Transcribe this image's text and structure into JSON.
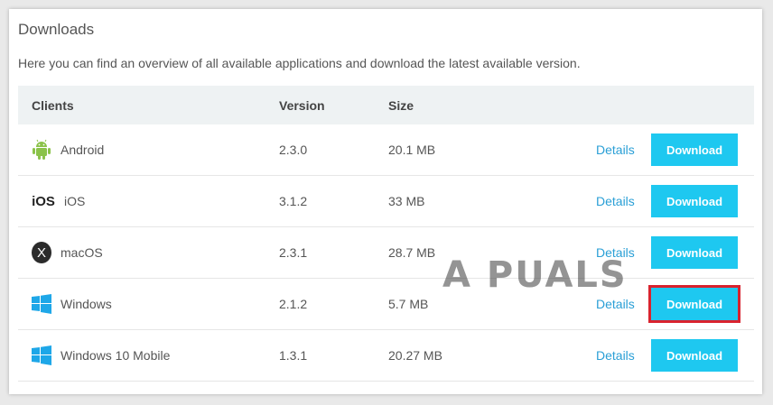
{
  "section": {
    "title": "Downloads",
    "description": "Here you can find an overview of all available applications and download the latest available version."
  },
  "table": {
    "headers": {
      "client": "Clients",
      "version": "Version",
      "size": "Size"
    },
    "rows": [
      {
        "client": "Android",
        "icon": "android-icon",
        "version": "2.3.0",
        "size": "20.1 MB",
        "details": "Details",
        "download": "Download"
      },
      {
        "client": "iOS",
        "icon": "ios-icon",
        "icon_text": "iOS",
        "version": "3.1.2",
        "size": "33 MB",
        "details": "Details",
        "download": "Download"
      },
      {
        "client": "macOS",
        "icon": "macos-icon",
        "icon_text": "X",
        "version": "2.3.1",
        "size": "28.7 MB",
        "details": "Details",
        "download": "Download"
      },
      {
        "client": "Windows",
        "icon": "windows-icon",
        "version": "2.1.2",
        "size": "5.7 MB",
        "details": "Details",
        "download": "Download",
        "highlighted": true
      },
      {
        "client": "Windows 10 Mobile",
        "icon": "windows-icon",
        "version": "1.3.1",
        "size": "20.27 MB",
        "details": "Details",
        "download": "Download"
      }
    ]
  },
  "watermark": {
    "text": "A PUALS"
  },
  "colors": {
    "accent": "#1ec8f0",
    "link": "#2a9fd6",
    "highlight": "#d9232e",
    "header_bg": "#eef2f3",
    "android": "#8bc34a",
    "windows": "#1ea7e8"
  }
}
